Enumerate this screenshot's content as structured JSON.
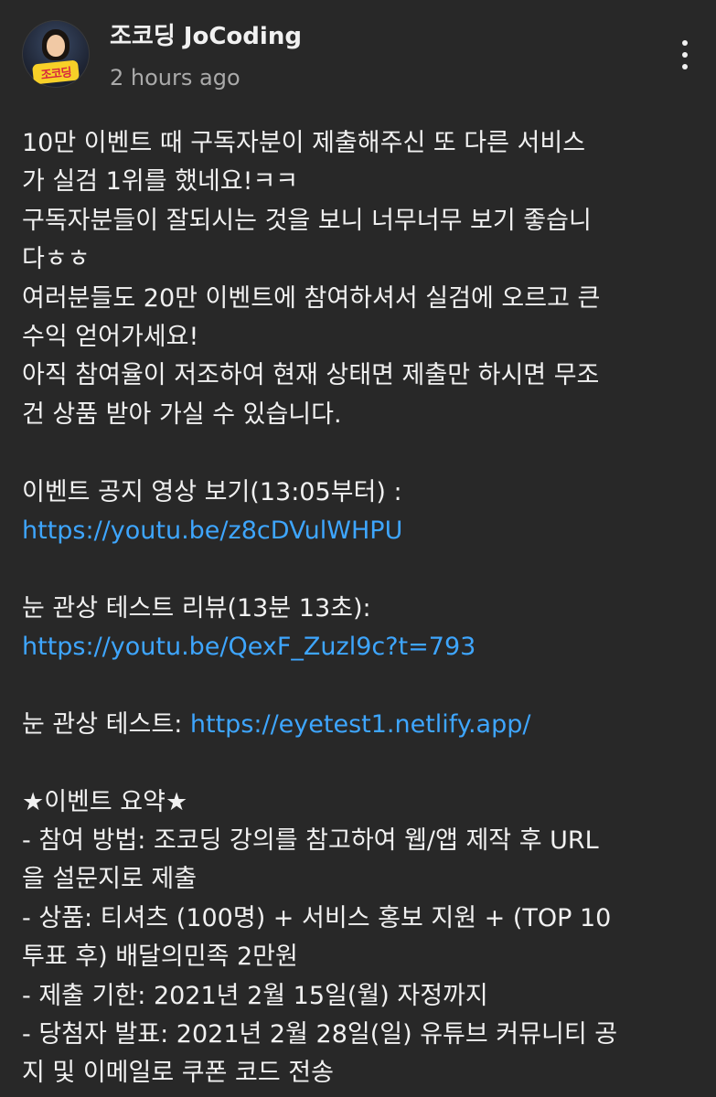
{
  "post": {
    "author": "조코딩 JoCoding",
    "time": "2 hours ago",
    "avatar_badge_text": "조코딩"
  },
  "body": {
    "p1": [
      "10만 이벤트 때 구독자분이 제출해주신 또 다른 서비스",
      "가 실검 1위를 했네요!ㅋㅋ",
      "구독자분들이 잘되시는 것을 보니 너무너무 보기 좋습니",
      "다ㅎㅎ",
      "여러분들도 20만 이벤트에 참여하셔서 실검에 오르고 큰",
      "수익 얻어가세요!",
      "아직 참여율이 저조하여 현재 상태면 제출만 하시면 무조",
      "건 상품 받아 가실 수 있습니다."
    ],
    "event_video_label": "이벤트 공지 영상 보기(13:05부터) :",
    "event_video_url": "https://youtu.be/z8cDVulWHPU",
    "review_label": "눈 관상 테스트 리뷰(13분 13초):",
    "review_url": "https://youtu.be/QexF_Zuzl9c?t=793",
    "test_label": "눈 관상 테스트: ",
    "test_url": "https://eyetest1.netlify.app/",
    "summary_title": "★이벤트 요약★",
    "summary": [
      "- 참여 방법: 조코딩 강의를 참고하여 웹/앱 제작 후 URL",
      "을 설문지로 제출",
      "- 상품: 티셔츠 (100명) + 서비스 홍보 지원 + (TOP 10",
      "투표 후) 배달의민족 2만원",
      "- 제출 기한: 2021년 2월 15일(월) 자정까지",
      "- 당첨자 발표: 2021년 2월 28일(일) 유튜브 커뮤니티 공",
      "지 및 이메일로 쿠폰 코드 전송"
    ]
  },
  "colors": {
    "background": "#282828",
    "text": "#f1f1f1",
    "secondary_text": "#aaaaaa",
    "link": "#3ea6ff"
  },
  "icons": {
    "menu": "more-vert-icon"
  }
}
